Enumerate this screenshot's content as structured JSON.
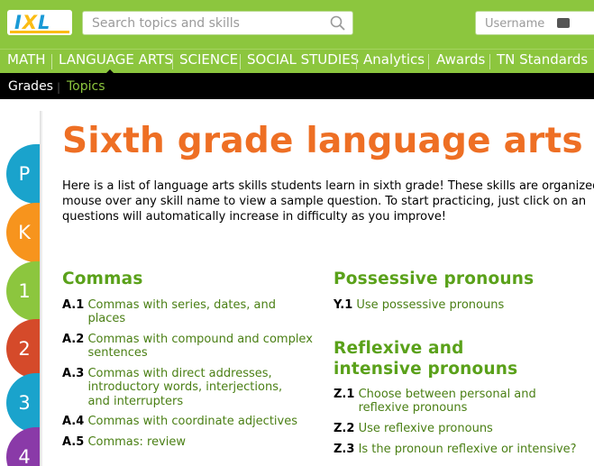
{
  "brand": {
    "logo_text_i": "I",
    "logo_text_x": "X",
    "logo_text_l": "L",
    "blue": "#1a9ad6",
    "yellow": "#fbbc15",
    "green": "#8cc63e"
  },
  "search": {
    "placeholder": "Search topics and skills"
  },
  "login": {
    "username_placeholder": "Username"
  },
  "nav": {
    "items": [
      "MATH",
      "LANGUAGE ARTS",
      "SCIENCE",
      "SOCIAL STUDIES",
      "Analytics",
      "Awards",
      "TN Standards"
    ],
    "active": "LANGUAGE ARTS"
  },
  "subnav": {
    "grades": "Grades",
    "separator": "|",
    "topics": "Topics"
  },
  "grades": [
    "P",
    "K",
    "1",
    "2",
    "3",
    "4"
  ],
  "main": {
    "title": "Sixth grade language arts",
    "intro": "Here is a list of language arts skills students learn in sixth grade! These skills are organized\nmouse over any skill name to view a sample question. To start practicing, just click on an\nquestions will automatically increase in difficulty as you improve!"
  },
  "categories": {
    "commas": {
      "title": "Commas",
      "skills": [
        {
          "code": "A.1",
          "text": "Commas with series, dates, and places"
        },
        {
          "code": "A.2",
          "text": "Commas with compound and complex sentences"
        },
        {
          "code": "A.3",
          "text": "Commas with direct addresses, introductory words, interjections, and interrupters"
        },
        {
          "code": "A.4",
          "text": "Commas with coordinate adjectives"
        },
        {
          "code": "A.5",
          "text": "Commas: review"
        }
      ]
    },
    "possessive": {
      "title": "Possessive pronouns",
      "skills": [
        {
          "code": "Y.1",
          "text": "Use possessive pronouns"
        }
      ]
    },
    "reflexive": {
      "title": "Reflexive and intensive pronouns",
      "skills": [
        {
          "code": "Z.1",
          "text": "Choose between personal and reflexive pronouns"
        },
        {
          "code": "Z.2",
          "text": "Use reflexive pronouns"
        },
        {
          "code": "Z.3",
          "text": "Is the pronoun reflexive or intensive?"
        }
      ]
    }
  }
}
